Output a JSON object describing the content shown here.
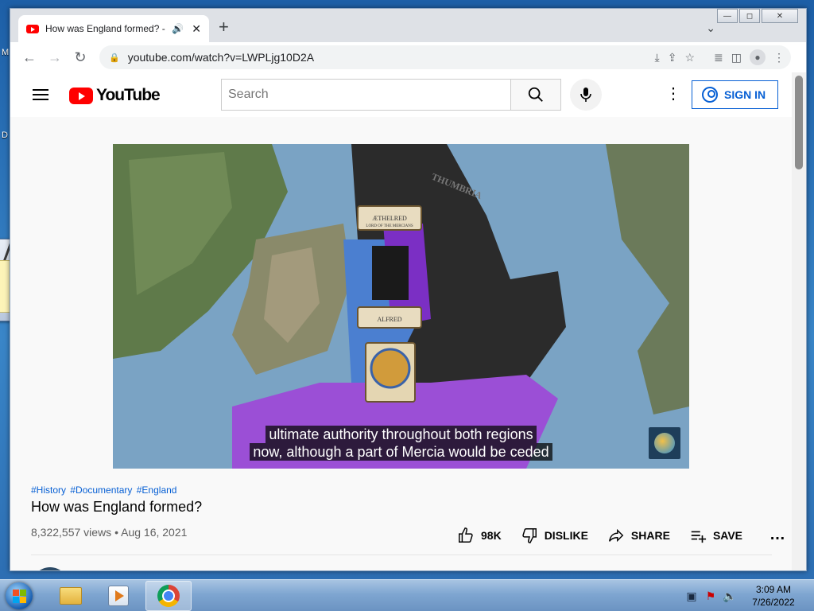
{
  "desktop": {
    "frag_m": "M",
    "frag_d": "D"
  },
  "browser": {
    "tab_title": "How was England formed? -",
    "tab_audio": "🔊",
    "tab_close": "✕",
    "new_tab": "+",
    "tab_search": "⌄",
    "window_controls": {
      "minimize": "—",
      "maximize": "◻",
      "close": "✕"
    },
    "nav": {
      "back": "←",
      "forward": "→",
      "reload": "↻"
    },
    "url": "youtube.com/watch?v=LWPLjg10D2A",
    "lock": "🔒",
    "right_icons": {
      "install": "⤓",
      "share": "⇪",
      "bookmark": "☆",
      "media": "≣",
      "sidepanel": "◫",
      "menu": "⋮"
    }
  },
  "youtube": {
    "logo_text": "YouTube",
    "search_placeholder": "Search",
    "more": "⋮",
    "sign_in": "SIGN IN",
    "player": {
      "caption_line1": "ultimate authority throughout both regions",
      "caption_line2": "now, although a part of Mercia would be ceded",
      "map_labels": {
        "north": "THUMBRIA",
        "banner_top": "ÆTHELRED",
        "banner_top_sub": "LORD OF THE MERCIANS",
        "banner_bottom": "ALFRED"
      }
    },
    "hashtags": [
      "#History",
      "#Documentary",
      "#England"
    ],
    "title": "How was England formed?",
    "views": "8,322,557 views",
    "date_sep": "•",
    "date": "Aug 16, 2021",
    "actions": {
      "likes": "98K",
      "dislike": "DISLIKE",
      "share": "SHARE",
      "save": "SAVE",
      "more": "…"
    }
  },
  "taskbar": {
    "time": "3:09 AM",
    "date": "7/26/2022"
  }
}
